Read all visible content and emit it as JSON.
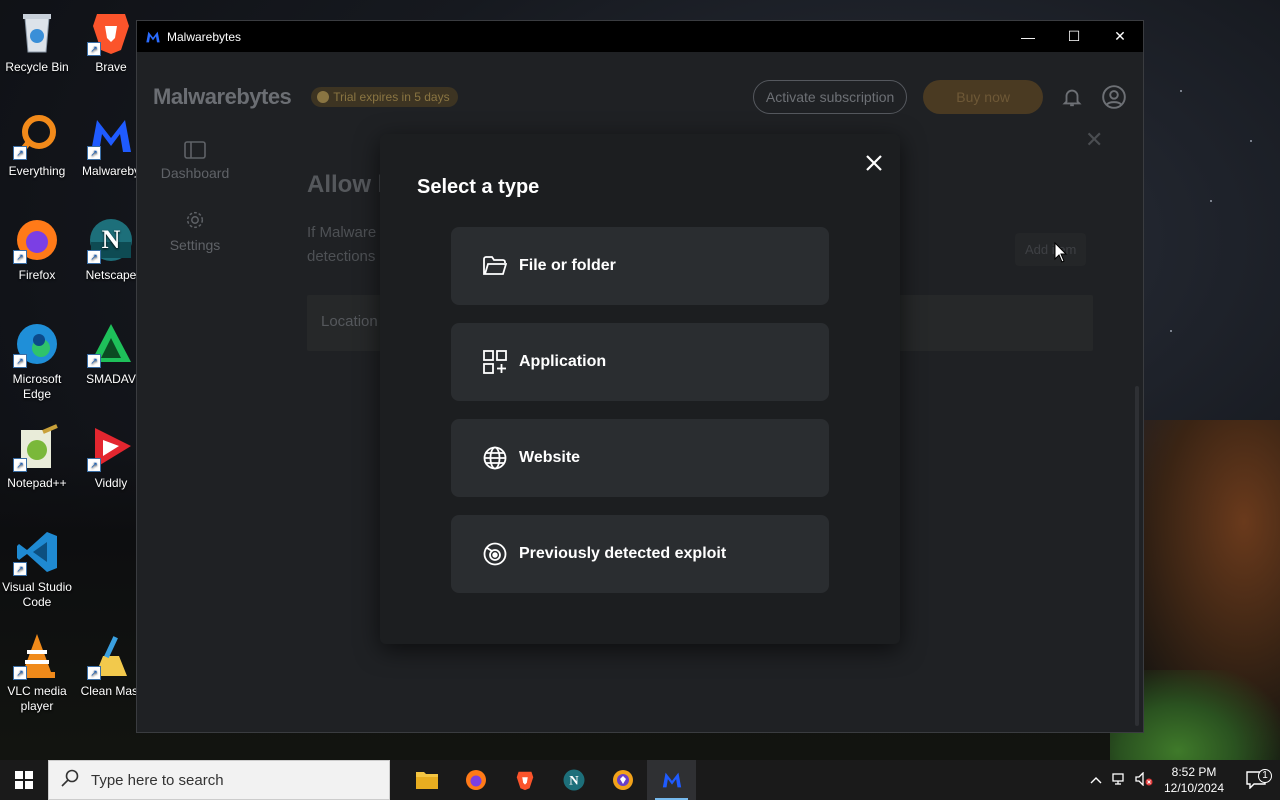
{
  "desktop": {
    "icons": [
      {
        "label": "Recycle Bin",
        "icon": "recycle-bin-icon"
      },
      {
        "label": "Brave",
        "icon": "brave-icon"
      },
      {
        "label": "Everything",
        "icon": "everything-search-icon"
      },
      {
        "label": "Malwareby",
        "icon": "malwarebytes-icon"
      },
      {
        "label": "Firefox",
        "icon": "firefox-icon"
      },
      {
        "label": "Netscape",
        "icon": "netscape-icon"
      },
      {
        "label": "Microsoft Edge",
        "icon": "edge-icon"
      },
      {
        "label": "SMADAV",
        "icon": "smadav-icon"
      },
      {
        "label": "Notepad++",
        "icon": "notepadpp-icon"
      },
      {
        "label": "Viddly",
        "icon": "viddly-icon"
      },
      {
        "label": "Visual Studio Code",
        "icon": "vscode-icon"
      },
      {
        "label": "VLC media player",
        "icon": "vlc-icon"
      },
      {
        "label": "Clean Mast",
        "icon": "clean-master-icon"
      }
    ]
  },
  "window": {
    "title": "Malwarebytes",
    "controls": {
      "minimize": "—",
      "maximize": "☐",
      "close": "✕"
    }
  },
  "header": {
    "brand": "Malwarebytes",
    "trial": "Trial expires in 5 days",
    "activate": "Activate subscription",
    "buy": "Buy now"
  },
  "sidenav": {
    "items": [
      {
        "label": "Dashboard",
        "icon": "dashboard-icon"
      },
      {
        "label": "Settings",
        "icon": "gear-icon"
      }
    ]
  },
  "background": {
    "title": "Allow l",
    "desc_line1": "If Malware",
    "desc_line2": "detections",
    "table_header": "Location",
    "add_item": "Add item"
  },
  "modal": {
    "title": "Select a type",
    "options": [
      {
        "label": "File or folder",
        "icon": "folder-icon"
      },
      {
        "label": "Application",
        "icon": "application-icon"
      },
      {
        "label": "Website",
        "icon": "globe-icon"
      },
      {
        "label": "Previously detected exploit",
        "icon": "exploit-icon"
      }
    ]
  },
  "taskbar": {
    "search_placeholder": "Type here to search",
    "time": "8:52 PM",
    "date": "12/10/2024",
    "notification_count": "1",
    "apps": [
      "file-explorer-icon",
      "firefox-icon",
      "brave-icon",
      "netscape-icon",
      "privacy-browser-icon",
      "malwarebytes-icon"
    ]
  },
  "colors": {
    "accent": "#2b6cff",
    "modal_bg": "#1c1e20",
    "option_bg": "#2a2d30",
    "buy_button": "#4a3a22"
  }
}
